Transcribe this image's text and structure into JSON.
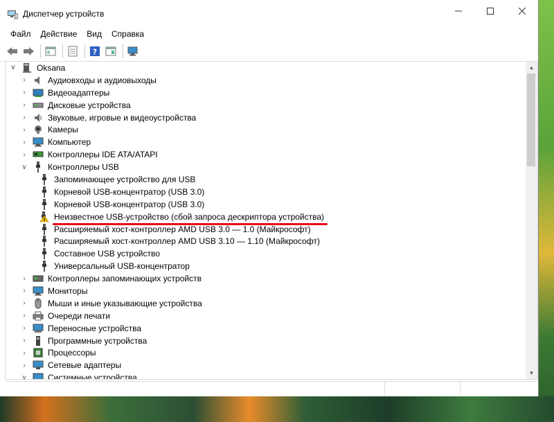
{
  "window": {
    "title": "Диспетчер устройств",
    "icon": "device-manager-icon",
    "controls": [
      "minimize-icon",
      "maximize-icon",
      "close-icon"
    ]
  },
  "menu": [
    "Файл",
    "Действие",
    "Вид",
    "Справка"
  ],
  "toolbar": {
    "buttons": [
      "back-icon",
      "forward-icon",
      "show-hide-tree-icon",
      "properties-icon",
      "help-icon",
      "show-hide-action-pane-icon",
      "scan-hardware-icon"
    ]
  },
  "tree": {
    "root": "Oksana",
    "categories": [
      {
        "label": "Аудиовходы и аудиовыходы",
        "icon": "speaker-icon"
      },
      {
        "label": "Видеоадаптеры",
        "icon": "display-adapter-icon"
      },
      {
        "label": "Дисковые устройства",
        "icon": "disk-drive-icon"
      },
      {
        "label": "Звуковые, игровые и видеоустройства",
        "icon": "sound-icon"
      },
      {
        "label": "Камеры",
        "icon": "camera-icon"
      },
      {
        "label": "Компьютер",
        "icon": "computer-icon"
      },
      {
        "label": "Контроллеры IDE ATA/ATAPI",
        "icon": "ide-controller-icon"
      },
      {
        "label": "Контроллеры USB",
        "icon": "usb-icon"
      }
    ],
    "usb_children": [
      {
        "label": "Запоминающее устройство для USB",
        "icon": "usb-plug-icon"
      },
      {
        "label": "Корневой USB-концентратор (USB 3.0)",
        "icon": "usb-plug-icon"
      },
      {
        "label": "Корневой USB-концентратор (USB 3.0)",
        "icon": "usb-plug-icon"
      },
      {
        "label": "Неизвестное USB-устройство (сбой запроса дескриптора устройства)",
        "icon": "usb-warning-icon"
      },
      {
        "label": "Расширяемый хост-контроллер AMD USB 3.0 — 1.0 (Майкрософт)",
        "icon": "usb-plug-icon"
      },
      {
        "label": "Расширяемый хост-контроллер AMD USB 3.10 — 1.10 (Майкрософт)",
        "icon": "usb-plug-icon"
      },
      {
        "label": "Составное USB устройство",
        "icon": "usb-plug-icon"
      },
      {
        "label": "Универсальный USB-концентратор",
        "icon": "usb-plug-icon"
      }
    ],
    "categories_after": [
      {
        "label": "Контроллеры запоминающих устройств",
        "icon": "storage-controller-icon"
      },
      {
        "label": "Мониторы",
        "icon": "monitor-icon"
      },
      {
        "label": "Мыши и иные указывающие устройства",
        "icon": "mouse-icon"
      },
      {
        "label": "Очереди печати",
        "icon": "printer-icon"
      },
      {
        "label": "Переносные устройства",
        "icon": "portable-device-icon"
      },
      {
        "label": "Программные устройства",
        "icon": "software-device-icon"
      },
      {
        "label": "Процессоры",
        "icon": "processor-icon"
      },
      {
        "label": "Сетевые адаптеры",
        "icon": "network-adapter-icon"
      },
      {
        "label": "Системные устройства",
        "icon": "system-device-icon"
      }
    ]
  },
  "colors": {
    "highlight_underline": "#e8001a",
    "warning": "#f5c400"
  }
}
